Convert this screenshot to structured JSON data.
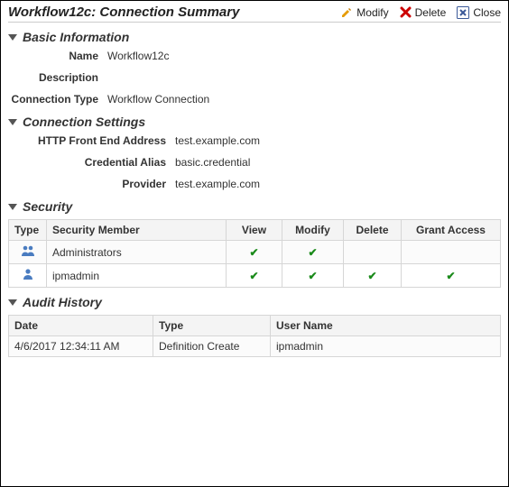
{
  "header": {
    "title": "Workflow12c: Connection Summary",
    "modify_label": "Modify",
    "delete_label": "Delete",
    "close_label": "Close"
  },
  "basic_info": {
    "heading": "Basic Information",
    "name_label": "Name",
    "name_value": "Workflow12c",
    "description_label": "Description",
    "description_value": "",
    "connection_type_label": "Connection Type",
    "connection_type_value": "Workflow Connection"
  },
  "connection_settings": {
    "heading": "Connection Settings",
    "http_label": "HTTP Front End Address",
    "http_value": "test.example.com",
    "credential_label": "Credential Alias",
    "credential_value": "basic.credential",
    "provider_label": "Provider",
    "provider_value": "test.example.com"
  },
  "security": {
    "heading": "Security",
    "columns": {
      "type": "Type",
      "member": "Security Member",
      "view": "View",
      "modify": "Modify",
      "delete": "Delete",
      "grant": "Grant Access"
    },
    "rows": [
      {
        "icon": "group",
        "member": "Administrators",
        "view": true,
        "modify": true,
        "delete": false,
        "grant": false
      },
      {
        "icon": "user",
        "member": "ipmadmin",
        "view": true,
        "modify": true,
        "delete": true,
        "grant": true
      }
    ]
  },
  "audit": {
    "heading": "Audit History",
    "columns": {
      "date": "Date",
      "type": "Type",
      "user": "User Name"
    },
    "rows": [
      {
        "date": "4/6/2017 12:34:11 AM",
        "type": "Definition Create",
        "user": "ipmadmin"
      }
    ]
  }
}
